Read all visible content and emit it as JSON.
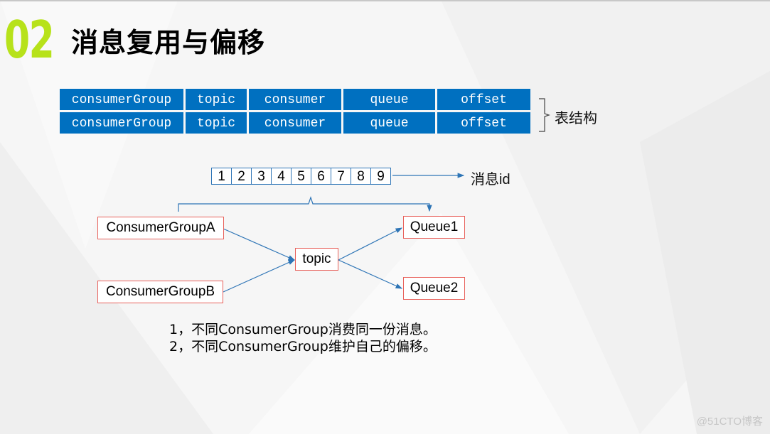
{
  "header": {
    "section_number": "02",
    "title": "消息复用与偏移"
  },
  "table": {
    "rows": [
      [
        "consumerGroup",
        "topic",
        "consumer",
        "queue",
        "offset"
      ],
      [
        "consumerGroup",
        "topic",
        "consumer",
        "queue",
        "offset"
      ]
    ],
    "brace_label": "表结构"
  },
  "message_ids": {
    "cells": [
      "1",
      "2",
      "3",
      "4",
      "5",
      "6",
      "7",
      "8",
      "9"
    ],
    "label": "消息id"
  },
  "diagram": {
    "consumer_group_a": "ConsumerGroupA",
    "consumer_group_b": "ConsumerGroupB",
    "topic": "topic",
    "queue1": "Queue1",
    "queue2": "Queue2"
  },
  "notes": [
    "1，不同ConsumerGroup消费同一份消息。",
    "2，不同ConsumerGroup维护自己的偏移。"
  ],
  "watermark": "@51CTO博客",
  "colors": {
    "accent_green": "#b7e21a",
    "table_blue": "#0070c0",
    "box_border": "#e8605a",
    "arrow_blue": "#2e75b6"
  }
}
